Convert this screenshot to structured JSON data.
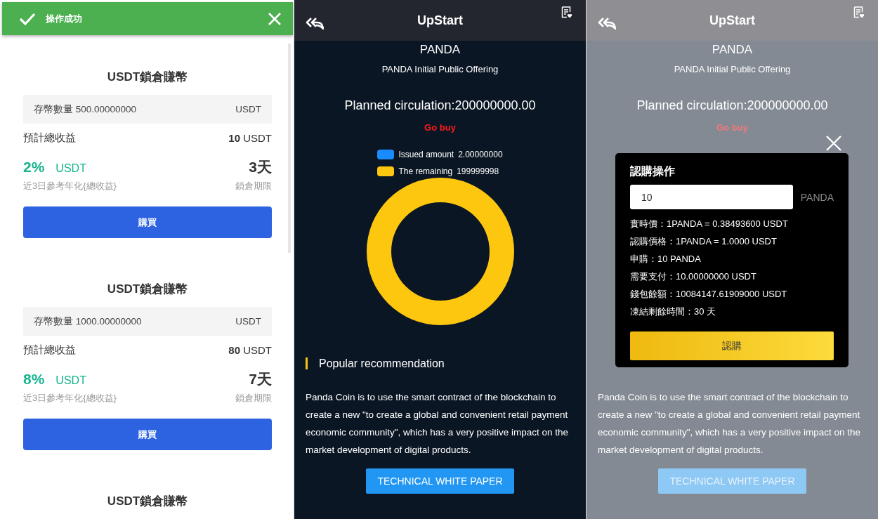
{
  "toast": {
    "message": "操作成功"
  },
  "products": [
    {
      "title": "USDT鎖倉賺幣",
      "deposit_label": "存幣數量 500.00000000",
      "deposit_unit": "USDT",
      "profit_label": "預計總收益",
      "profit": "**10** USDT",
      "rate": "2%",
      "rate_unit": "USDT",
      "days": "3天",
      "rate_caption": "近3日參考年化{總收益}",
      "days_caption": "鎖倉期限",
      "button": "購買"
    },
    {
      "title": "USDT鎖倉賺幣",
      "deposit_label": "存幣數量 1000.00000000",
      "deposit_unit": "USDT",
      "profit_label": "預計總收益",
      "profit": "**80** USDT",
      "rate": "8%",
      "rate_unit": "USDT",
      "days": "7天",
      "rate_caption": "近3日參考年化{總收益}",
      "days_caption": "鎖倉期限",
      "button": "購買"
    },
    {
      "title": "USDT鎖倉賺幣"
    }
  ],
  "detail_panels": [
    {
      "dimmed": false,
      "title": "UpStart",
      "coin": "PANDA",
      "subtitle": "PANDA Initial Public Offering",
      "circulation": "Planned circulation:200000000.00",
      "go_buy": "Go buy",
      "legend": [
        {
          "label": "Issued amount",
          "value": "2.00000000",
          "color": "#1a8cff"
        },
        {
          "label": "The remaining",
          "value": "199999998",
          "color": "#fdc70f"
        }
      ],
      "section_title": "Popular recommendation",
      "description": "Panda Coin is to use the smart contract of the blockchain to create a new \"to create a global and convenient retail payment economic community\", which has a very positive impact on the market development of digital products.",
      "white_paper_button": "TECHNICAL WHITE PAPER"
    },
    {
      "dimmed": true,
      "title": "UpStart",
      "coin": "PANDA",
      "subtitle": "PANDA Initial Public Offering",
      "circulation": "Planned circulation:200000000.00",
      "go_buy": "Go buy",
      "description": "Panda Coin is to use the smart contract of the blockchain to create a new \"to create a global and convenient retail payment economic community\", which has a very positive impact on the market development of digital products.",
      "white_paper_button": "TECHNICAL WHITE PAPER",
      "dialog": {
        "title": "認購操作",
        "amount": "10",
        "unit": "PANDA",
        "lines": [
          "實時價：1PANDA = 0.38493600 USDT",
          "認購價格：1PANDA = 1.0000 USDT",
          "申購：10 PANDA",
          "需要支付：10.00000000 USDT",
          "錢包餘額：10084147.61909000 USDT",
          "凍結剩餘時間：30 天"
        ],
        "button": "認購"
      }
    }
  ]
}
